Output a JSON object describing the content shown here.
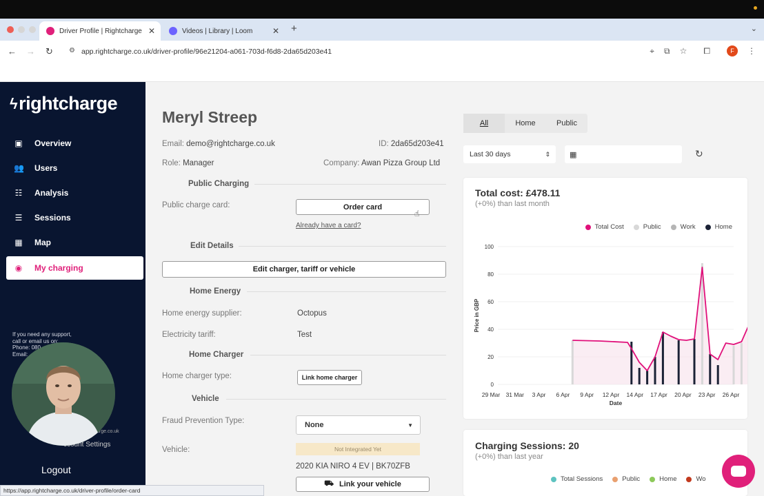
{
  "browser": {
    "tabs": [
      {
        "title": "Driver Profile | Rightcharge",
        "active": true
      },
      {
        "title": "Videos | Library | Loom",
        "active": false
      }
    ],
    "url": "app.rightcharge.co.uk/driver-profile/96e21204-a061-703d-f6d8-2da65d203e41",
    "profile_initial": "F",
    "status_url": "https://app.rightcharge.co.uk/driver-profile/order-card"
  },
  "sidebar": {
    "logo": "rightcharge",
    "items": [
      {
        "label": "Overview",
        "icon": "layout-icon"
      },
      {
        "label": "Users",
        "icon": "users-icon"
      },
      {
        "label": "Analysis",
        "icon": "analysis-icon"
      },
      {
        "label": "Sessions",
        "icon": "sessions-icon"
      },
      {
        "label": "Map",
        "icon": "map-icon"
      },
      {
        "label": "My charging",
        "icon": "user-circle-icon"
      }
    ],
    "support_line1": "If you need any support,",
    "support_line2": "call or email us on:",
    "support_phone": "Phone: 080",
    "support_email": "Email: ",
    "site_fragment": "arge.co.uk",
    "account_settings": "ccount Settings",
    "logout": "Logout"
  },
  "profile": {
    "name": "Meryl Streep",
    "email_label": "Email:",
    "email": "demo@rightcharge.co.uk",
    "id_label": "ID:",
    "id": "2da65d203e41",
    "role_label": "Role:",
    "role": "Manager",
    "company_label": "Company:",
    "company": "Awan Pizza Group Ltd"
  },
  "public_charging": {
    "title": "Public Charging",
    "card_label": "Public charge card:",
    "order_button": "Order card",
    "have_card_link": "Already have a card?"
  },
  "edit_details": {
    "title": "Edit Details",
    "button": "Edit charger, tariff or vehicle"
  },
  "home_energy": {
    "title": "Home Energy",
    "supplier_label": "Home energy supplier:",
    "supplier": "Octopus",
    "tariff_label": "Electricity tariff:",
    "tariff": "Test"
  },
  "home_charger": {
    "title": "Home Charger",
    "type_label": "Home charger type:",
    "link_button": "Link home charger"
  },
  "vehicle": {
    "title": "Vehicle",
    "fraud_label": "Fraud Prevention Type:",
    "fraud_value": "None",
    "vehicle_label": "Vehicle:",
    "badge": "Not Integrated Yet",
    "vehicle_name": "2020 KIA NIRO 4 EV | BK70ZFB",
    "link_button": "Link your vehicle"
  },
  "filters": {
    "tabs": [
      "All",
      "Home",
      "Public"
    ],
    "active": "All",
    "range": "Last 30 days"
  },
  "cost_card": {
    "title": "Total cost: £478.11",
    "subtitle": "(+0%) than last month",
    "legend": [
      {
        "name": "Total Cost",
        "color": "#e0107a"
      },
      {
        "name": "Public",
        "color": "#d8d8d8"
      },
      {
        "name": "Work",
        "color": "#b5b5b5"
      },
      {
        "name": "Home",
        "color": "#1b2236"
      }
    ]
  },
  "sessions_card": {
    "title": "Charging Sessions: 20",
    "subtitle": "(+0%) than last year",
    "legend": [
      {
        "name": "Total Sessions",
        "color": "#5ec3c0"
      },
      {
        "name": "Public",
        "color": "#e9a070"
      },
      {
        "name": "Home",
        "color": "#8dc95a"
      },
      {
        "name": "Wo",
        "color": "#c23a1e"
      }
    ]
  },
  "chart_data": {
    "type": "line",
    "title": "Total cost: £478.11",
    "xlabel": "Date",
    "ylabel": "Price in GBP",
    "ylim": [
      0,
      100
    ],
    "yticks": [
      0,
      20,
      40,
      60,
      80,
      100
    ],
    "xticks": [
      "29 Mar",
      "31 Mar",
      "3 Apr",
      "6 Apr",
      "9 Apr",
      "12 Apr",
      "14 Apr",
      "17 Apr",
      "20 Apr",
      "23 Apr",
      "26 Apr"
    ],
    "xmax": 30,
    "legend_position": "top-right",
    "series": [
      {
        "name": "Total Cost",
        "points": [
          [
            9.5,
            32
          ],
          [
            13,
            31.5
          ],
          [
            16.5,
            30.5
          ],
          [
            17,
            26
          ],
          [
            18,
            16
          ],
          [
            19,
            10
          ],
          [
            20,
            20
          ],
          [
            21,
            38
          ],
          [
            22,
            35
          ],
          [
            23,
            32.5
          ],
          [
            24,
            32
          ],
          [
            25,
            33
          ],
          [
            26,
            85
          ],
          [
            27,
            22
          ],
          [
            28,
            18
          ],
          [
            29,
            30
          ],
          [
            30,
            29
          ],
          [
            31,
            31
          ],
          [
            32,
            44
          ],
          [
            33,
            30
          ],
          [
            34,
            20
          ]
        ]
      },
      {
        "name": "Home",
        "bars": [
          [
            17,
            31
          ],
          [
            18,
            12
          ],
          [
            19,
            10
          ],
          [
            20,
            20
          ],
          [
            21,
            38
          ],
          [
            23,
            32
          ],
          [
            25,
            33
          ],
          [
            27,
            22
          ],
          [
            28,
            14
          ],
          [
            32,
            12
          ],
          [
            33.5,
            9
          ]
        ]
      },
      {
        "name": "Public",
        "bars": [
          [
            9.5,
            32
          ],
          [
            26,
            88
          ],
          [
            31,
            30
          ],
          [
            30,
            28
          ]
        ]
      }
    ]
  }
}
